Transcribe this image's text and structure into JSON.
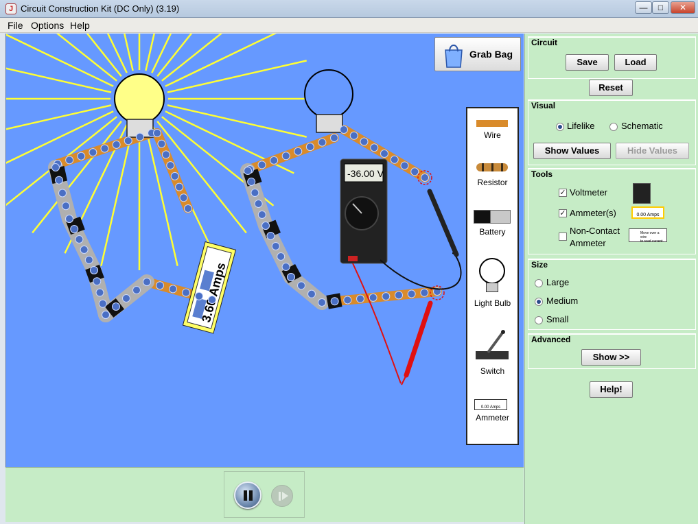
{
  "window": {
    "title": "Circuit Construction Kit (DC Only) (3.19)",
    "minimize": "—",
    "maximize": "□",
    "close": "✕"
  },
  "menu": [
    "File",
    "Options",
    "Help"
  ],
  "workspace": {
    "grab_bag_label": "Grab Bag",
    "ammeter_reading": "3.60 Amps",
    "voltmeter_reading": "-36.00 V"
  },
  "toolbox": {
    "items": [
      {
        "label": "Wire",
        "icon": "wire-icon"
      },
      {
        "label": "Resistor",
        "icon": "resistor-icon"
      },
      {
        "label": "Battery",
        "icon": "battery-icon"
      },
      {
        "label": "Light Bulb",
        "icon": "light-bulb-icon"
      },
      {
        "label": "Switch",
        "icon": "switch-icon"
      },
      {
        "label": "Ammeter",
        "icon": "ammeter-icon"
      }
    ],
    "ammeter_icon_text": "0.00 Amps"
  },
  "panel": {
    "circuit": {
      "title": "Circuit",
      "save": "Save",
      "load": "Load"
    },
    "reset": "Reset",
    "visual": {
      "title": "Visual",
      "lifelike": "Lifelike",
      "schematic": "Schematic",
      "selected": "Lifelike",
      "show_values": "Show Values",
      "hide_values": "Hide Values"
    },
    "tools": {
      "title": "Tools",
      "voltmeter": {
        "label": "Voltmeter",
        "checked": true
      },
      "ammeters": {
        "label": "Ammeter(s)",
        "checked": true,
        "icon_text": "0.00 Amps"
      },
      "non_contact": {
        "label_line1": "Non-Contact",
        "label_line2": "Ammeter",
        "checked": false,
        "icon_text_line1": "Move over a wire",
        "icon_text_line2": "to read current."
      }
    },
    "size": {
      "title": "Size",
      "options": [
        "Large",
        "Medium",
        "Small"
      ],
      "selected": "Medium"
    },
    "advanced": {
      "title": "Advanced",
      "show": "Show >>"
    },
    "help": "Help!"
  },
  "colors": {
    "workspace_bg": "#6699ff",
    "panel_bg": "#c6ecc6",
    "wire": "#d98b2b",
    "electron": "#4a6fc4",
    "light_rays": "#ffff33",
    "probe_red": "#e01010"
  }
}
